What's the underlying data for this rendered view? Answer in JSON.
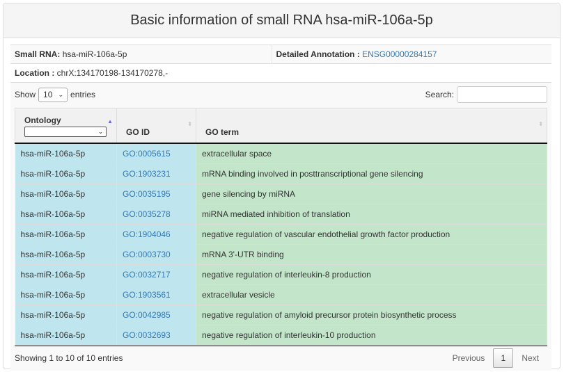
{
  "title": "Basic information of small RNA hsa-miR-106a-5p",
  "info": {
    "small_rna_label": "Small RNA:",
    "small_rna_value": "hsa-miR-106a-5p",
    "annotation_label": "Detailed Annotation :",
    "annotation_value": "ENSG00000284157",
    "location_label": "Location :",
    "location_value": "chrX:134170198-134170278,-"
  },
  "table_controls": {
    "show_label": "Show",
    "entries_value": "10",
    "entries_label": "entries",
    "search_label": "Search:",
    "search_value": ""
  },
  "table": {
    "columns": [
      "Ontology",
      "GO ID",
      "GO term"
    ],
    "ontology_filter_value": "",
    "rows": [
      {
        "ontology": "hsa-miR-106a-5p",
        "go_id": "GO:0005615",
        "go_term": "extracellular space"
      },
      {
        "ontology": "hsa-miR-106a-5p",
        "go_id": "GO:1903231",
        "go_term": "mRNA binding involved in posttranscriptional gene silencing"
      },
      {
        "ontology": "hsa-miR-106a-5p",
        "go_id": "GO:0035195",
        "go_term": "gene silencing by miRNA"
      },
      {
        "ontology": "hsa-miR-106a-5p",
        "go_id": "GO:0035278",
        "go_term": "miRNA mediated inhibition of translation"
      },
      {
        "ontology": "hsa-miR-106a-5p",
        "go_id": "GO:1904046",
        "go_term": "negative regulation of vascular endothelial growth factor production"
      },
      {
        "ontology": "hsa-miR-106a-5p",
        "go_id": "GO:0003730",
        "go_term": "mRNA 3'-UTR binding"
      },
      {
        "ontology": "hsa-miR-106a-5p",
        "go_id": "GO:0032717",
        "go_term": "negative regulation of interleukin-8 production"
      },
      {
        "ontology": "hsa-miR-106a-5p",
        "go_id": "GO:1903561",
        "go_term": "extracellular vesicle"
      },
      {
        "ontology": "hsa-miR-106a-5p",
        "go_id": "GO:0042985",
        "go_term": "negative regulation of amyloid precursor protein biosynthetic process"
      },
      {
        "ontology": "hsa-miR-106a-5p",
        "go_id": "GO:0032693",
        "go_term": "negative regulation of interleukin-10 production"
      }
    ]
  },
  "footer": {
    "info_text": "Showing 1 to 10 of 10 entries",
    "previous_label": "Previous",
    "current_page": "1",
    "next_label": "Next"
  },
  "icons": {
    "chevron": "⌄",
    "sort_asc": "▲",
    "sort_both": "⬍"
  },
  "colors": {
    "ontology_cell_bg": "#bfe6ee",
    "goid_cell_bg": "#bfe6ee",
    "goterm_cell_bg": "#c3e6cb",
    "link": "#337ab7"
  }
}
